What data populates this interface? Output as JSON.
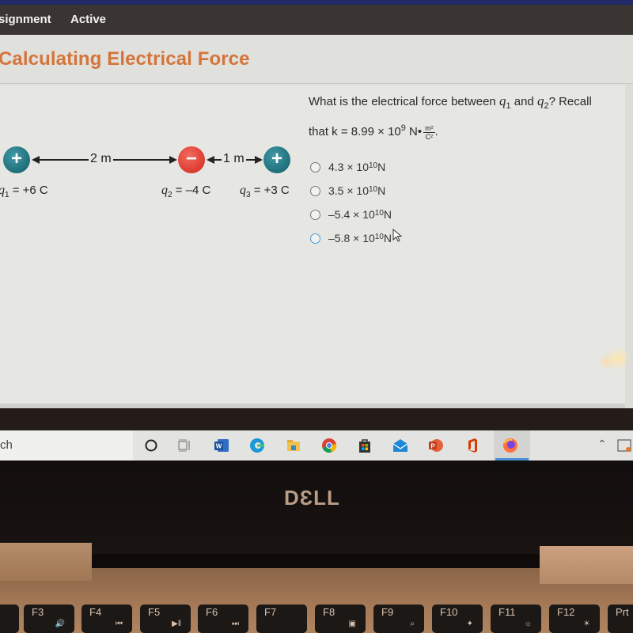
{
  "nav": {
    "assignment_label": "signment",
    "active_label": "Active"
  },
  "page": {
    "title": "Calculating Electrical Force"
  },
  "diagram": {
    "charges": [
      {
        "symbol": "+",
        "sign": "positive",
        "label_var": "q",
        "label_sub": "1",
        "label_value": " = +6 C"
      },
      {
        "symbol": "−",
        "sign": "negative",
        "label_var": "q",
        "label_sub": "2",
        "label_value": " = –4 C"
      },
      {
        "symbol": "+",
        "sign": "positive",
        "label_var": "q",
        "label_sub": "3",
        "label_value": " = +3 C"
      }
    ],
    "distances": [
      "2 m",
      "1 m"
    ],
    "colors": {
      "positive": "#1f6f7a",
      "negative": "#dc3b30"
    }
  },
  "question": {
    "line1_prefix": "What is the electrical force between ",
    "q1_var": "q",
    "q1_sub": "1",
    "and": " and ",
    "q2_var": "q",
    "q2_sub": "2",
    "line1_suffix": "? Recall",
    "line2_prefix": "that k = 8.99 × 10",
    "k_exp": "9",
    "k_unit": " N•",
    "frac_num": "m²",
    "frac_den": "C²",
    "line2_suffix": "."
  },
  "options": [
    {
      "mantissa": "4.3 × 10",
      "exp": "10",
      "unit": " N"
    },
    {
      "mantissa": "3.5 × 10",
      "exp": "10",
      "unit": " N"
    },
    {
      "mantissa": "–5.4 × 10",
      "exp": "10",
      "unit": " N"
    },
    {
      "mantissa": "–5.8 × 10",
      "exp": "10",
      "unit": " N"
    }
  ],
  "taskbar": {
    "search_text": "ch",
    "apps": [
      "cortana-icon",
      "task-view-icon",
      "word-icon",
      "edge-icon",
      "file-explorer-icon",
      "chrome-icon",
      "store-icon",
      "mail-icon",
      "powerpoint-icon",
      "office-icon",
      "firefox-icon"
    ],
    "active_app": "firefox-icon"
  },
  "laptop": {
    "brand": "DƐLL",
    "fkeys": [
      {
        "label": "F3",
        "icon": "🔊"
      },
      {
        "label": "F4",
        "icon": "⏮"
      },
      {
        "label": "F5",
        "icon": "▶‖"
      },
      {
        "label": "F6",
        "icon": "⏭"
      },
      {
        "label": "F7",
        "icon": ""
      },
      {
        "label": "F8",
        "icon": "▣"
      },
      {
        "label": "F9",
        "icon": "⌕"
      },
      {
        "label": "F10",
        "icon": "✦"
      },
      {
        "label": "F11",
        "icon": "☼"
      },
      {
        "label": "F12",
        "icon": "☀"
      },
      {
        "label": "Prt",
        "icon": ""
      }
    ]
  }
}
